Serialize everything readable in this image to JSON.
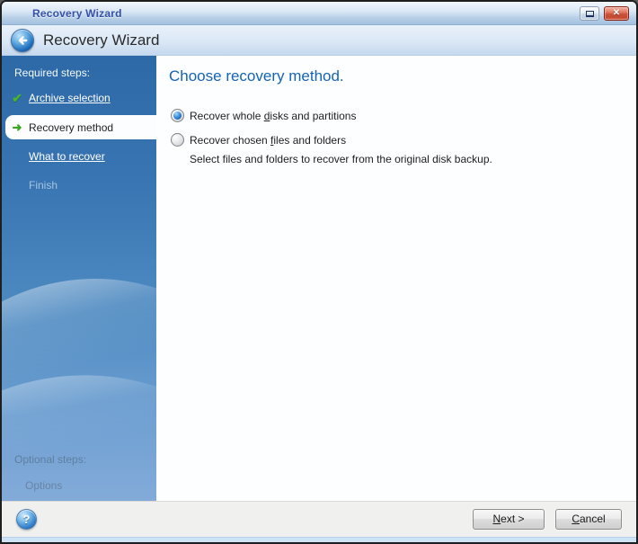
{
  "window": {
    "title": "Recovery Wizard"
  },
  "titlebar": {
    "close_glyph": "✕"
  },
  "header": {
    "title": "Recovery Wizard"
  },
  "icons": {
    "check_glyph": "✔",
    "arrow_glyph": "➜",
    "help_glyph": "?"
  },
  "sidebar": {
    "section_label": "Required steps:",
    "steps": [
      {
        "label": "Archive selection",
        "state": "done"
      },
      {
        "label": "Recovery method",
        "state": "current"
      },
      {
        "label": "What to recover",
        "state": "link"
      },
      {
        "label": "Finish",
        "state": "disabled"
      }
    ],
    "optional_section_label": "Optional steps:",
    "optional_steps": [
      {
        "label": "Options"
      }
    ]
  },
  "main": {
    "heading": "Choose recovery method.",
    "options": [
      {
        "pre": "Recover whole ",
        "accel": "d",
        "post": "isks and partitions",
        "selected": true
      },
      {
        "pre": "Recover chosen ",
        "accel": "f",
        "post": "iles and folders",
        "selected": false
      }
    ],
    "description": "Select files and folders to recover from the original disk backup."
  },
  "footer": {
    "next": {
      "accel": "N",
      "post": "ext >"
    },
    "cancel": {
      "accel": "C",
      "post": "ancel"
    }
  },
  "colors": {
    "accent_blue": "#1464b4",
    "sidebar_blue": "#2d69a6",
    "success_green": "#3caa28",
    "close_red": "#c34a32"
  }
}
